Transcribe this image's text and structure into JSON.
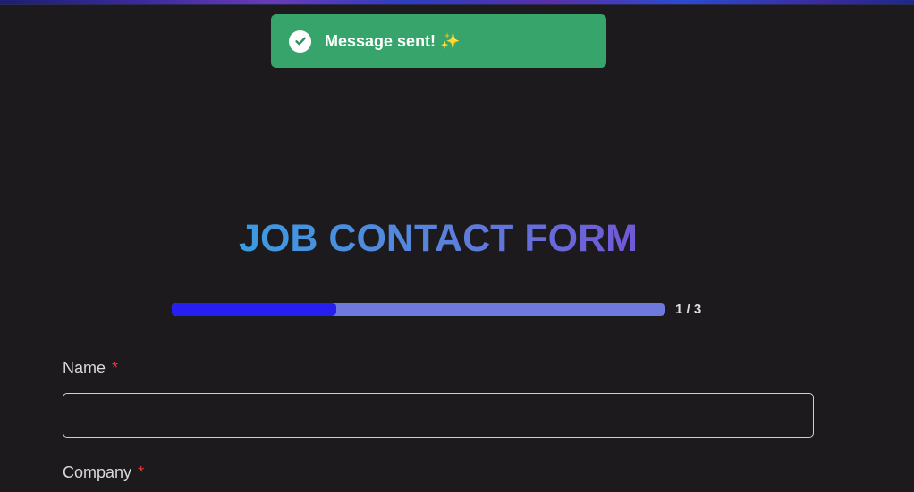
{
  "toast": {
    "message": "Message sent! ✨",
    "icon": "check-circle-icon",
    "color": "#37a56b"
  },
  "form": {
    "title": "JOB CONTACT FORM",
    "progress": {
      "fraction": 0.333,
      "label": "1 / 3",
      "fill_color": "#261ff0",
      "track_color": "#6f78dc"
    },
    "fields": [
      {
        "label": "Name",
        "required_marker": "*",
        "value": ""
      },
      {
        "label": "Company",
        "required_marker": "*",
        "value": ""
      }
    ]
  }
}
